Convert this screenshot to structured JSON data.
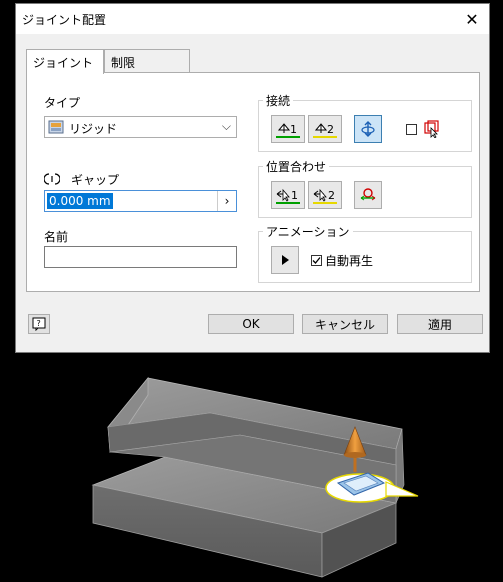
{
  "dialog": {
    "title": "ジョイント配置",
    "close_symbol": "✕"
  },
  "tabs": [
    {
      "label": "ジョイント",
      "active": true
    },
    {
      "label": "制限",
      "active": false
    }
  ],
  "left": {
    "type_label": "タイプ",
    "type_value": "リジッド",
    "gap_label": "ギャップ",
    "gap_value": "0.000 mm",
    "gap_arrow": "›",
    "name_label": "名前",
    "name_value": ""
  },
  "groups": {
    "connect": {
      "title": "接続",
      "btn1": "1",
      "btn2": "2"
    },
    "align": {
      "title": "位置合わせ",
      "btn1": "1",
      "btn2": "2"
    },
    "animation": {
      "title": "アニメーション",
      "autoplay_label": "自動再生",
      "autoplay_checked": true
    }
  },
  "footer": {
    "ok": "OK",
    "cancel": "キャンセル",
    "apply": "適用"
  },
  "colors": {
    "accent": "#0078d7",
    "green": "#00a000",
    "yellow": "#e6d800",
    "red": "#d00000",
    "cone": "#e08a1e"
  }
}
